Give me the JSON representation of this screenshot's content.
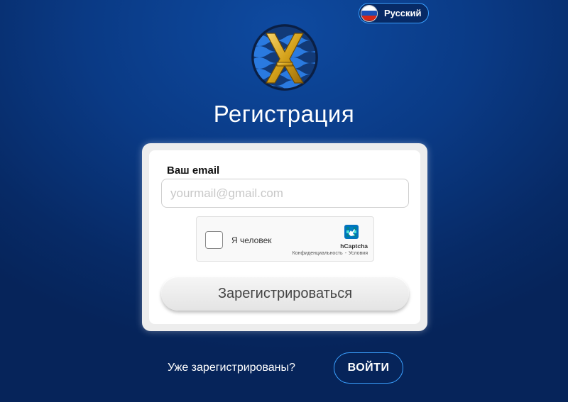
{
  "language": {
    "label": "Русский",
    "flag_colors": [
      "#ffffff",
      "#1c4fb8",
      "#d62718"
    ]
  },
  "logo": {
    "name": "logo-emblem",
    "colors": {
      "ring": "#0d2a5c",
      "wave": "#1f6fd6",
      "letter": "#d4a11a"
    }
  },
  "page": {
    "title": "Регистрация"
  },
  "form": {
    "email_label": "Ваш email",
    "email_placeholder": "yourmail@gmail.com",
    "email_value": "",
    "register_label": "Зарегистрироваться"
  },
  "captcha": {
    "label": "Я человек",
    "brand": "hCaptcha",
    "privacy": "Конфиденциальность",
    "separator": "-",
    "terms": "Условия",
    "checked": false
  },
  "footer": {
    "already_text": "Уже зарегистрированы?",
    "login_label": "ВОЙТИ"
  },
  "colors": {
    "accent": "#3aa0ff",
    "background": "#0a3a85"
  }
}
